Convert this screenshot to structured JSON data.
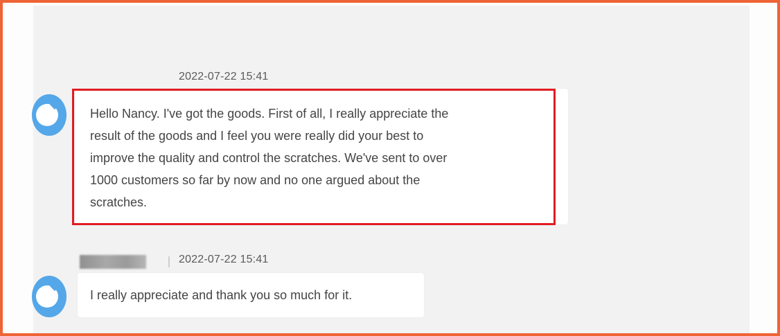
{
  "colors": {
    "frame_border": "#ee6436",
    "chat_background": "#f2f2f2",
    "bubble_background": "#ffffff",
    "highlight_border": "#e21b22",
    "avatar_color": "#54a7e8"
  },
  "messages": [
    {
      "timestamp": "2022-07-22 15:41",
      "lines": [
        "Hello Nancy. I've got the goods. First of all, I really appreciate the",
        "result of the goods and I feel you were really did your best to",
        "improve the quality and control the scratches. We've sent to over",
        "1000 customers so far by now and no one argued about the",
        "scratches."
      ],
      "avatar_icon": "chat-avatar-icon"
    },
    {
      "timestamp": "2022-07-22 15:41",
      "lines": [
        "I really appreciate and thank you so much for it."
      ],
      "avatar_icon": "chat-avatar-icon"
    }
  ]
}
